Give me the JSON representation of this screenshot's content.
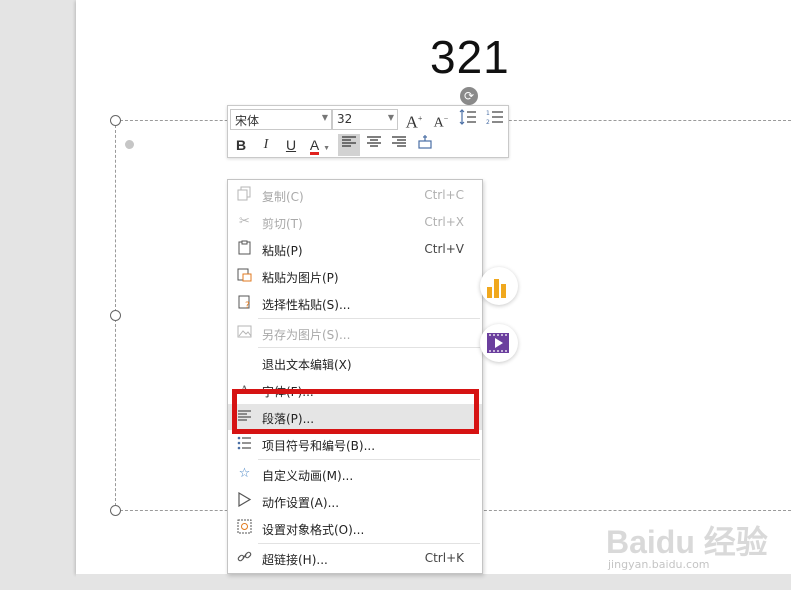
{
  "slide": {
    "title_text": "321"
  },
  "mini_toolbar": {
    "font_family": "宋体",
    "font_size": "32",
    "bold_label": "B",
    "italic_label": "I",
    "underline_label": "U",
    "font_color_label": "A",
    "font_color_accent": "#e0211d",
    "grow_label": "A",
    "shrink_label": "A"
  },
  "context_menu": {
    "items": [
      {
        "label": "复制(C)",
        "shortcut": "Ctrl+C",
        "icon": "copy-icon",
        "enabled": false
      },
      {
        "label": "剪切(T)",
        "shortcut": "Ctrl+X",
        "icon": "scissors-icon",
        "enabled": false
      },
      {
        "label": "粘贴(P)",
        "shortcut": "Ctrl+V",
        "icon": "paste-icon",
        "enabled": true
      },
      {
        "label": "粘贴为图片(P)",
        "shortcut": "",
        "icon": "paste-as-picture-icon",
        "enabled": true
      },
      {
        "label": "选择性粘贴(S)...",
        "shortcut": "",
        "icon": "paste-special-icon",
        "enabled": true
      },
      {
        "label": "另存为图片(S)...",
        "shortcut": "",
        "icon": "save-picture-icon",
        "enabled": false
      },
      {
        "label": "退出文本编辑(X)",
        "shortcut": "",
        "icon": "",
        "enabled": true
      },
      {
        "label": "字体(F)...",
        "shortcut": "",
        "icon": "font-icon",
        "enabled": true
      },
      {
        "label": "段落(P)...",
        "shortcut": "",
        "icon": "paragraph-icon",
        "enabled": true,
        "highlighted": true
      },
      {
        "label": "项目符号和编号(B)...",
        "shortcut": "",
        "icon": "bullets-icon",
        "enabled": true
      },
      {
        "label": "自定义动画(M)...",
        "shortcut": "",
        "icon": "animation-star-icon",
        "enabled": true
      },
      {
        "label": "动作设置(A)...",
        "shortcut": "",
        "icon": "play-triangle-icon",
        "enabled": true
      },
      {
        "label": "设置对象格式(O)...",
        "shortcut": "",
        "icon": "format-object-icon",
        "enabled": true
      },
      {
        "label": "超链接(H)...",
        "shortcut": "Ctrl+K",
        "icon": "link-icon",
        "enabled": true
      }
    ]
  },
  "floating_buttons": {
    "chart_color": "#f0a81e",
    "video_color": "#6b3f9e"
  },
  "annotation": {
    "highlight_color": "#d61313"
  },
  "watermark": {
    "main": "Baidu 经验",
    "sub": "jingyan.baidu.com"
  }
}
